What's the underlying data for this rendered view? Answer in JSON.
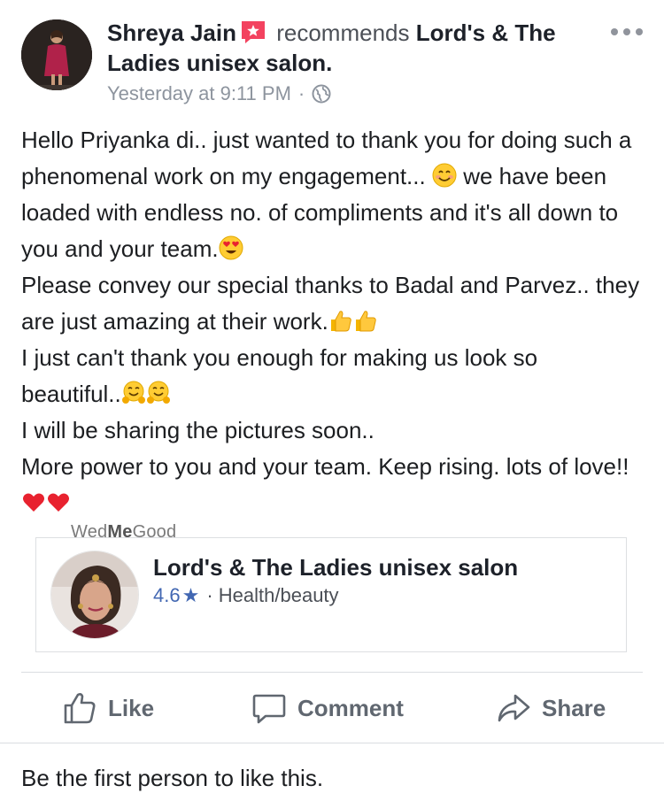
{
  "header": {
    "author_name": "Shreya Jain",
    "verb": "recommends",
    "page_name": "Lord's & The Ladies unisex salon",
    "page_period": ".",
    "timestamp": "Yesterday at 9:11 PM",
    "separator": "·",
    "privacy_icon": "globe-icon",
    "more_icon": "more-options-icon"
  },
  "post": {
    "lines": [
      "Hello Priyanka di.. just wanted to thank you for doing such a phenomenal work on my engagement...",
      "we have been loaded with endless no. of compliments and it's all down to you and your team.",
      "Please convey our special thanks to Badal and Parvez.. they are just amazing at their work.",
      "I just can't thank you enough for making us look so beautiful..",
      "I will be sharing the pictures soon..",
      "More power to you and your team. Keep rising. lots of love!!"
    ]
  },
  "watermark": {
    "part1": "Wed",
    "part2": "Me",
    "part3": "Good"
  },
  "card": {
    "title": "Lord's & The Ladies unisex salon",
    "rating": "4.6",
    "star": "★",
    "dot": "·",
    "category": "Health/beauty"
  },
  "actions": {
    "like": "Like",
    "comment": "Comment",
    "share": "Share"
  },
  "footer": {
    "text": "Be the first person to like this."
  },
  "colors": {
    "accent": "#4267b2",
    "recommend_badge": "#f3425f",
    "heart": "#e8222f"
  }
}
